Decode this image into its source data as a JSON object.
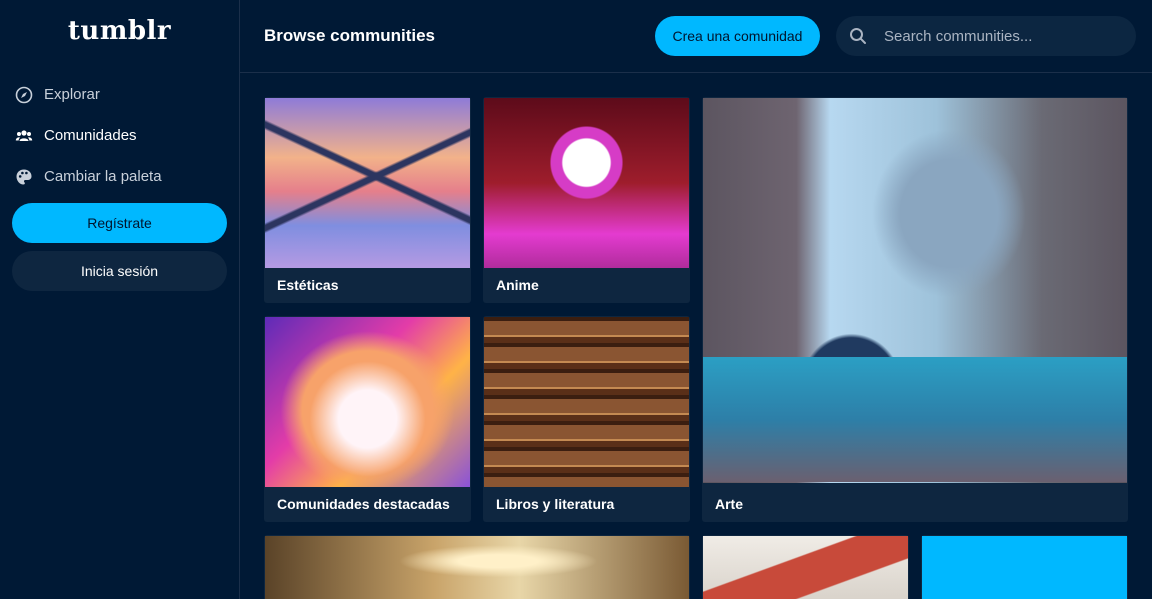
{
  "sidebar": {
    "logo": "tumblr",
    "nav": [
      {
        "label": "Explorar",
        "icon": "compass-icon"
      },
      {
        "label": "Comunidades",
        "icon": "people-icon"
      },
      {
        "label": "Cambiar la paleta",
        "icon": "palette-icon"
      }
    ],
    "register_label": "Regístrate",
    "login_label": "Inicia sesión"
  },
  "header": {
    "title": "Browse communities",
    "create_label": "Crea una comunidad",
    "search_placeholder": "Search communities..."
  },
  "cards": [
    {
      "label": "Estéticas"
    },
    {
      "label": "Anime"
    },
    {
      "label": "Comunidades destacadas"
    },
    {
      "label": "Libros y literatura"
    },
    {
      "label": "Arte"
    }
  ],
  "colors": {
    "background": "#001935",
    "accent": "#00b8ff",
    "card": "#0e2640"
  }
}
